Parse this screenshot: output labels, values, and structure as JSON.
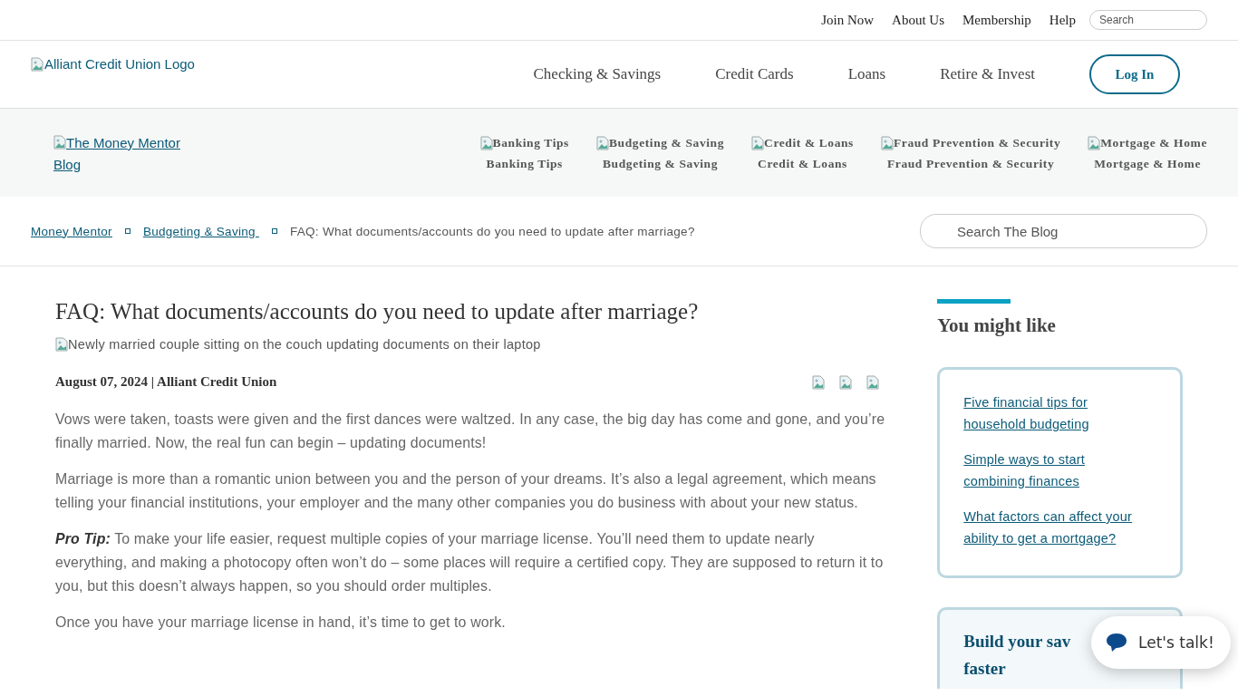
{
  "utility_nav": {
    "links": [
      "Join Now",
      "About Us",
      "Membership",
      "Help"
    ],
    "search": {
      "placeholder": "Search"
    }
  },
  "main_nav": {
    "logo_alt": "Alliant Credit Union Logo",
    "links": [
      "Checking & Savings",
      "Credit Cards",
      "Loans",
      "Retire & Invest"
    ],
    "login": "Log In"
  },
  "blog_nav": {
    "logo_alt": "The Money Mentor Blog",
    "categories": [
      {
        "image_alt": "Banking Tips",
        "label": "Banking Tips"
      },
      {
        "image_alt": "Budgeting & Saving",
        "label": "Budgeting & Saving"
      },
      {
        "image_alt": "Credit & Loans",
        "label": "Credit & Loans"
      },
      {
        "image_alt": "Fraud Prevention & Security",
        "label": "Fraud Prevention & Security"
      },
      {
        "image_alt": "Mortgage & Home",
        "label": "Mortgage & Home"
      }
    ]
  },
  "breadcrumb": {
    "items": [
      {
        "label": "Money Mentor",
        "kind": "link"
      },
      {
        "label": "Budgeting & Saving ",
        "kind": "link"
      },
      {
        "label": "FAQ: What documents/accounts do you need to update after marriage?",
        "kind": "current"
      }
    ],
    "search": {
      "placeholder": "Search The Blog"
    }
  },
  "article": {
    "title": "FAQ: What documents/accounts do you need to update after marriage?",
    "image_alt": "Newly married couple sitting on the couch updating documents on their laptop",
    "byline": "August 07, 2024 | Alliant Credit Union",
    "paragraphs": [
      "Vows were taken, toasts were given and the first dances were waltzed. In any case, the big day has come and gone, and you’re finally married. Now, the real fun can begin – updating documents!",
      "Marriage is more than a romantic union between you and the person of your dreams. It’s also a legal agreement, which means telling your financial institutions, your employer and the many other companies you do business with about your new status.",
      "**Pro Tip:** To make your life easier, request multiple copies of your marriage license. You’ll need them to update nearly everything, and making a photocopy often won’t do – some places will require a certified copy. They are supposed to return it to you, but this doesn’t always happen, so you should order multiples.",
      "Once you have your marriage license in hand, it’s time to get to work."
    ]
  },
  "sidebar": {
    "heading": "You might like",
    "links": [
      "Five financial tips for household budgeting",
      "Simple ways to start combining finances",
      "What factors can affect your ability to get a mortgage?"
    ],
    "promo": {
      "title_lines": [
        "Build your sav",
        "faster"
      ]
    }
  },
  "chat": {
    "label": "Let's talk!"
  }
}
